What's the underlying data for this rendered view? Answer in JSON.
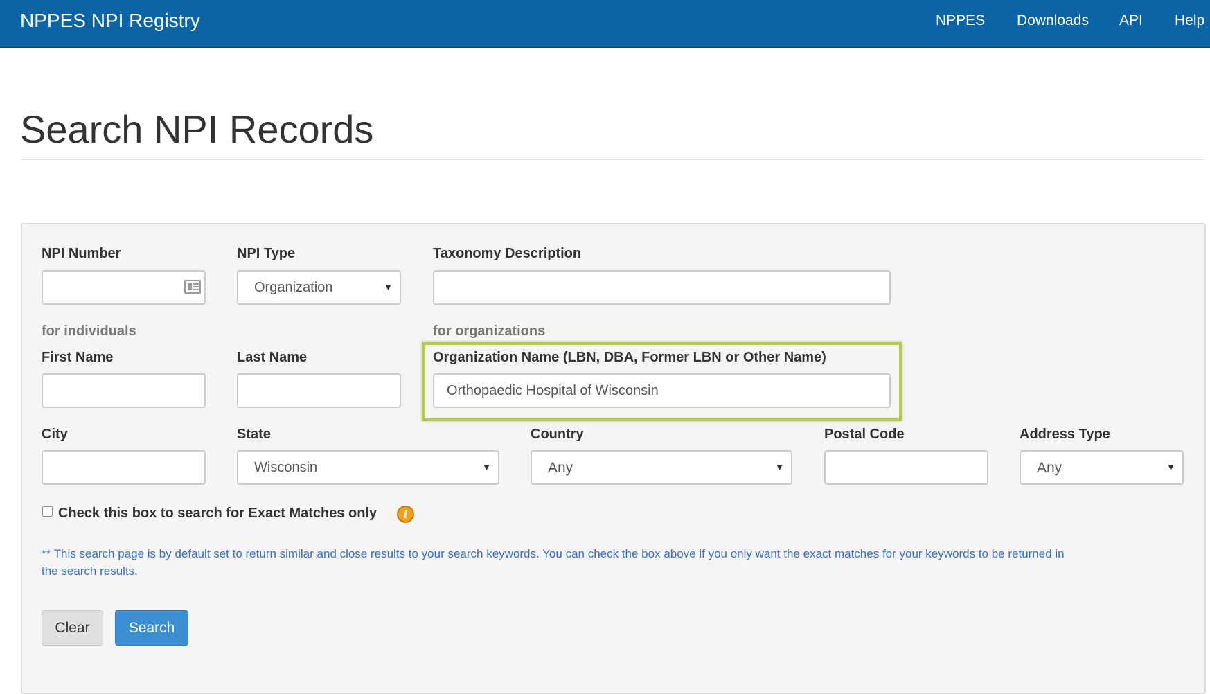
{
  "navbar": {
    "brand": "NPPES NPI Registry",
    "links": [
      "NPPES",
      "Downloads",
      "API",
      "Help"
    ]
  },
  "page_title": "Search NPI Records",
  "form": {
    "npi_number": {
      "label": "NPI Number",
      "value": ""
    },
    "npi_type": {
      "label": "NPI Type",
      "selected": "Organization"
    },
    "taxonomy": {
      "label": "Taxonomy Description",
      "value": ""
    },
    "for_individuals": "for individuals",
    "for_organizations": "for organizations",
    "first_name": {
      "label": "First Name",
      "value": ""
    },
    "last_name": {
      "label": "Last Name",
      "value": ""
    },
    "org_name": {
      "label": "Organization Name (LBN, DBA, Former LBN or Other Name)",
      "value": "Orthopaedic Hospital of Wisconsin"
    },
    "city": {
      "label": "City",
      "value": ""
    },
    "state": {
      "label": "State",
      "selected": "Wisconsin"
    },
    "country": {
      "label": "Country",
      "selected": "Any"
    },
    "postal_code": {
      "label": "Postal Code",
      "value": ""
    },
    "address_type": {
      "label": "Address Type",
      "selected": "Any"
    },
    "exact_match": {
      "label": "Check this box to search for Exact Matches only",
      "checked": false
    },
    "note": "** This search page is by default set to return similar and close results to your search keywords. You can check the box above if you only want the exact matches for your keywords to be returned in the search results.",
    "buttons": {
      "clear": "Clear",
      "search": "Search"
    }
  },
  "colors": {
    "navbar": "#0a64a6",
    "highlight": "#b2cc4a",
    "search_button": "#3d8fd3",
    "note_text": "#3a6fc4",
    "info_icon": "#f0a020"
  },
  "icons": [
    "id-card-icon",
    "chevron-down-icon",
    "info-icon"
  ]
}
